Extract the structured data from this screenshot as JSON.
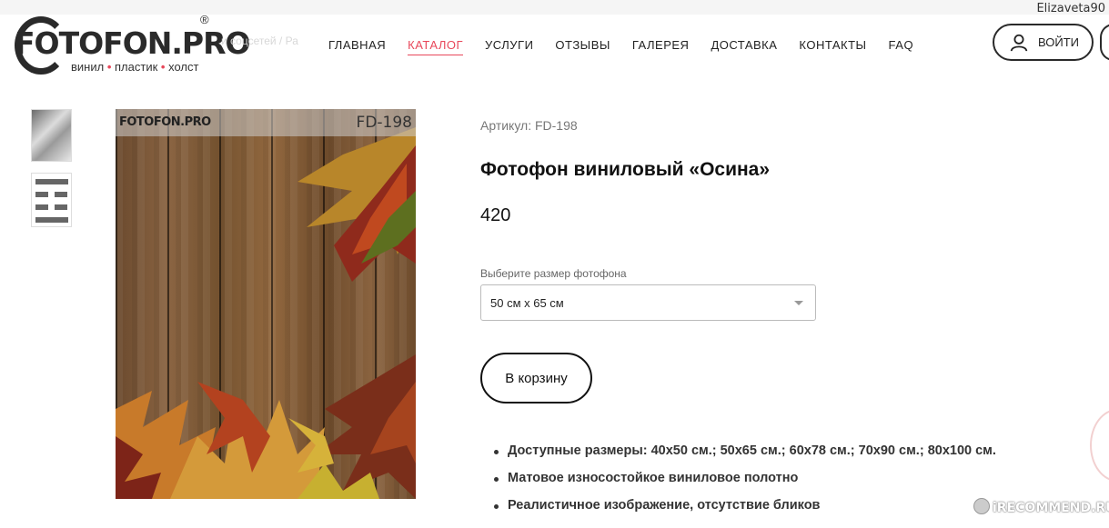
{
  "user": {
    "name": "Elizaveta90"
  },
  "logo": {
    "main": "FOTOFON.PRO",
    "registered": "®",
    "sub_parts": [
      "винил",
      "пластик",
      "холст"
    ],
    "background_text": "и соцсетей  /  Ра"
  },
  "nav": {
    "items": [
      {
        "label": "ГЛАВНАЯ",
        "active": false
      },
      {
        "label": "КАТАЛОГ",
        "active": true
      },
      {
        "label": "УСЛУГИ",
        "active": false
      },
      {
        "label": "ОТЗЫВЫ",
        "active": false
      },
      {
        "label": "ГАЛЕРЕЯ",
        "active": false
      },
      {
        "label": "ДОСТАВКА",
        "active": false
      },
      {
        "label": "КОНТАКТЫ",
        "active": false
      },
      {
        "label": "FAQ",
        "active": false
      }
    ],
    "accent_color": "#e8485b"
  },
  "login": {
    "label": "ВОЙТИ",
    "icon": "user-icon"
  },
  "product_image": {
    "logo": "FOTOFON.PRO",
    "code": "FD-198"
  },
  "product": {
    "article": "Артикул: FD-198",
    "title": "Фотофон виниловый «Осина»",
    "price": "420",
    "size_label": "Выберите размер фотофона",
    "size_selected": "50 см х 65 см",
    "cart_label": "В корзину"
  },
  "features": [
    "Доступные размеры: 40х50 см.; 50х65 см.; 60х78 см.; 70х90 см.; 80х100 см.",
    "Матовое износостойкое виниловое полотно",
    "Реалистичное изображение, отсутствие бликов"
  ],
  "watermark": "iRECOMMEND.RU"
}
